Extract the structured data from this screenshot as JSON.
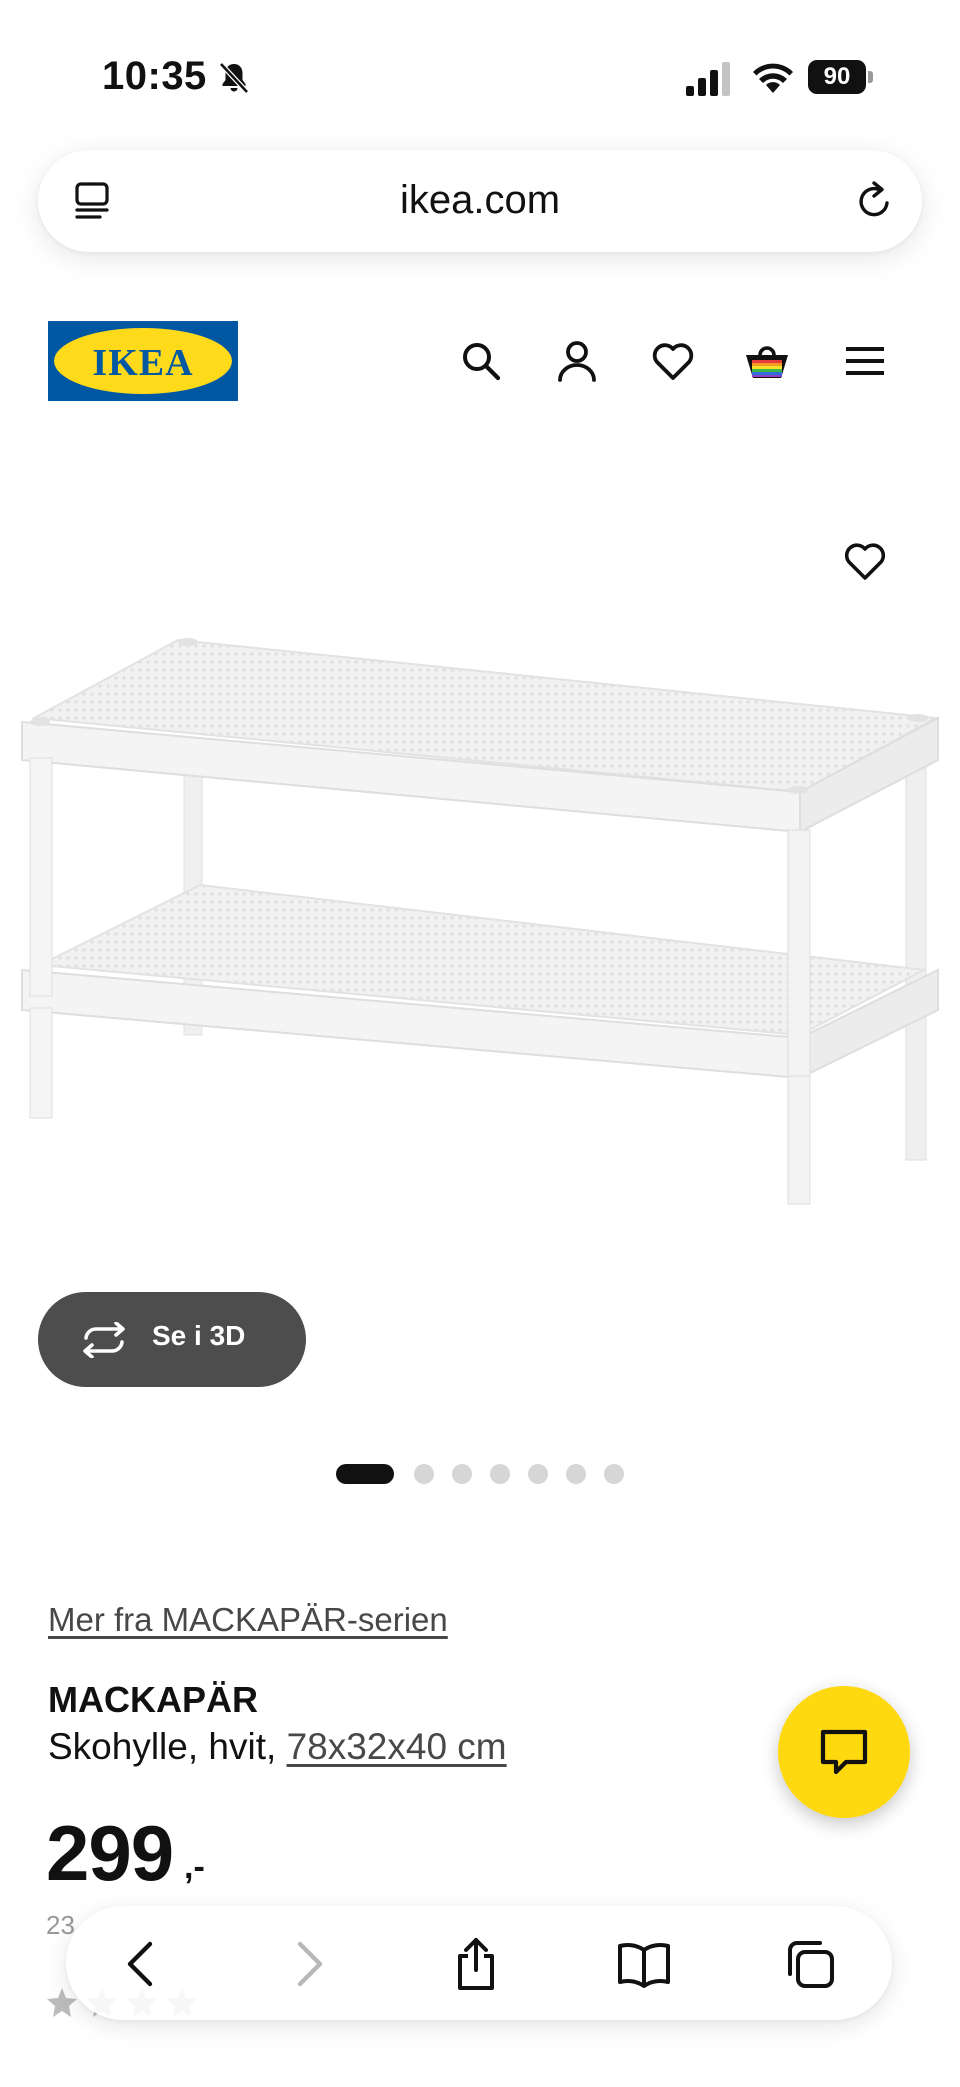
{
  "status_bar": {
    "time": "10:35",
    "battery": "90",
    "icons": [
      "bell-slash-icon",
      "cellular-signal-icon",
      "wifi-icon",
      "battery-icon"
    ]
  },
  "browser": {
    "url": "ikea.com",
    "icons": [
      "tabs-overview-icon",
      "reload-icon"
    ]
  },
  "header": {
    "logo_text": "IKEA",
    "logo_colors": {
      "blue": "#0058a3",
      "yellow": "#ffda1a"
    },
    "nav_icons": [
      "search-icon",
      "account-icon",
      "favorites-icon",
      "shopping-bag-icon",
      "menu-icon"
    ]
  },
  "product_media": {
    "favorite_icon": "heart-icon",
    "view_3d_label": "Se i 3D",
    "image_count": 7,
    "active_image_index": 0
  },
  "product": {
    "series_link": "Mer fra MACKAPÄR-serien",
    "name": "MACKAPÄR",
    "description_prefix": "Skohylle, hvit,",
    "dimensions": "78x32x40 cm",
    "price_integer": "299",
    "price_suffix": ",-",
    "partial_visible_text": "23"
  },
  "chat": {
    "icon": "chat-bubble-icon",
    "color": "#ffd90f"
  },
  "toolbar": {
    "icons": [
      "back-icon",
      "forward-icon",
      "share-icon",
      "bookmarks-icon",
      "tabs-icon"
    ]
  }
}
